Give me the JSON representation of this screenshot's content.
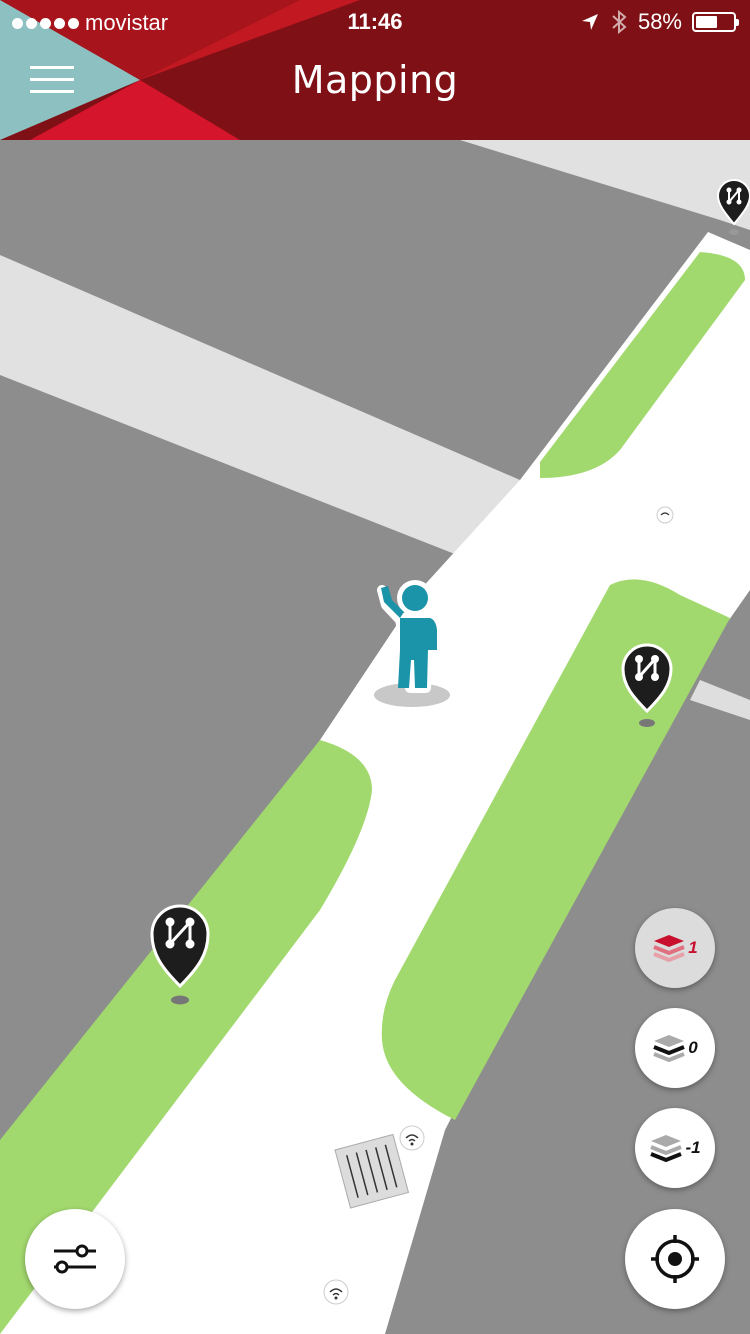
{
  "status_bar": {
    "carrier": "movistar",
    "time": "11:46",
    "battery": "58%",
    "battery_level": 0.58
  },
  "header": {
    "title": "Mapping",
    "menu_icon": "hamburger-menu-icon"
  },
  "map": {
    "markers": [
      {
        "name": "node-marker-top-right",
        "icon": "network-node-icon"
      },
      {
        "name": "node-marker-right",
        "icon": "network-node-icon"
      },
      {
        "name": "node-marker-left",
        "icon": "network-node-icon"
      }
    ],
    "user_icon": "person-waving-icon"
  },
  "floors": [
    {
      "label": "1",
      "active": true
    },
    {
      "label": "0",
      "active": false
    },
    {
      "label": "-1",
      "active": false
    }
  ],
  "controls": {
    "filter_icon": "sliders-icon",
    "locate_icon": "target-icon"
  },
  "colors": {
    "header_dark": "#7f1016",
    "header_red": "#d4152b",
    "header_teal": "#8cc0c1",
    "grass": "#a2d96e",
    "building": "#8d8d8d",
    "road_light": "#e1e1e1",
    "path": "#ffffff",
    "user": "#1b93a8",
    "active_floor": "#c8102e"
  }
}
